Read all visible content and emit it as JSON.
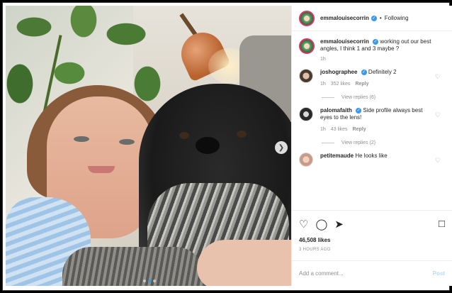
{
  "header": {
    "username": "emmalouisecorrin",
    "verified_icon": "verified-check-icon",
    "separator": "•",
    "follow_status": "Following"
  },
  "caption": {
    "username": "emmalouisecorrin",
    "text": "working out our best angles, I think 1 and 3 maybe ?",
    "time": "1h"
  },
  "comments": [
    {
      "username": "joshographee",
      "verified": true,
      "text": "Definitely 2",
      "time": "1h",
      "likes": "352 likes",
      "reply": "Reply",
      "view_replies": "View replies (6)"
    },
    {
      "username": "palomafaith",
      "verified": true,
      "text": "Side profile always best eyes to the lens!",
      "time": "1h",
      "likes": "43 likes",
      "reply": "Reply",
      "view_replies": "View replies (2)"
    },
    {
      "username": "petitemaude",
      "verified": false,
      "text": "He looks like"
    }
  ],
  "actions": {
    "icons": [
      "heart-icon",
      "comment-icon",
      "share-icon",
      "bookmark-icon"
    ],
    "likes": "46,508 likes",
    "time_ago": "3 HOURS AGO"
  },
  "add_comment": {
    "placeholder": "Add a comment...",
    "post_label": "Post"
  },
  "carousel": {
    "total_images": 3,
    "active_index": 1
  },
  "colors": {
    "accent": "#3897f0",
    "post_disabled": "#b2dffc",
    "muted": "#8e8e8e"
  }
}
